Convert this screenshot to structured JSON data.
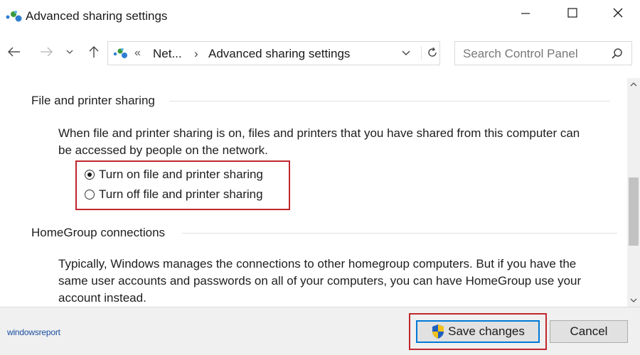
{
  "window": {
    "title": "Advanced sharing settings"
  },
  "nav": {
    "breadcrumb_chevrons": "«",
    "breadcrumb_parent": "Net...",
    "breadcrumb_separator": "›",
    "breadcrumb_current": "Advanced sharing settings",
    "search_placeholder": "Search Control Panel"
  },
  "file_printer": {
    "heading": "File and printer sharing",
    "description_line1": "When file and printer sharing is on, files and printers that you have shared from this computer can",
    "description_line2": "be accessed by people on the network.",
    "option_on": "Turn on file and printer sharing",
    "option_off": "Turn off file and printer sharing",
    "selected": "on"
  },
  "homegroup": {
    "heading": "HomeGroup connections",
    "description_line1": "Typically, Windows manages the connections to other homegroup computers. But if you have the",
    "description_line2": "same user accounts and passwords on all of your computers, you can have HomeGroup use your",
    "description_line3": "account instead."
  },
  "footer": {
    "logo_text": "windowsreport",
    "save_label": "Save changes",
    "cancel_label": "Cancel"
  },
  "colors": {
    "highlight": "#c0272d",
    "accent": "#0078d7"
  }
}
